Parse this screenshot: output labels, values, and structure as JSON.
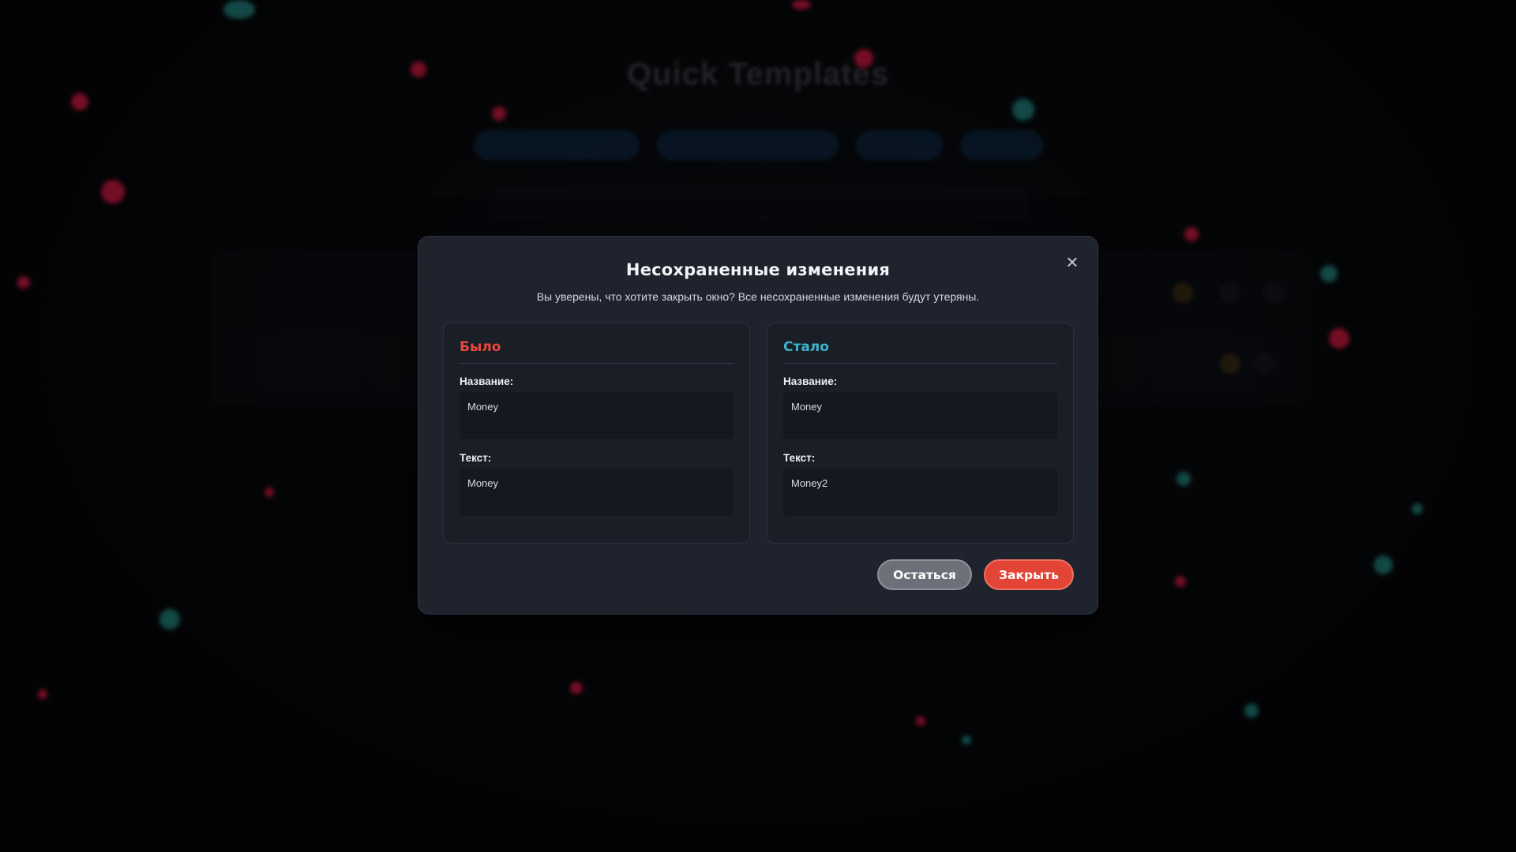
{
  "background": {
    "title": "Quick Templates"
  },
  "modal": {
    "title": "Несохраненные изменения",
    "description": "Вы уверены, что хотите закрыть окно? Все несохраненные изменения будут утеряны.",
    "close_icon": "×",
    "before": {
      "heading": "Было",
      "name_label": "Название:",
      "name_value": "Money",
      "text_label": "Текст:",
      "text_value": "Money"
    },
    "after": {
      "heading": "Стало",
      "name_label": "Название:",
      "name_value": "Money",
      "text_label": "Текст:",
      "text_value": "Money2"
    },
    "buttons": {
      "stay": "Остаться",
      "close": "Закрыть"
    }
  },
  "colors": {
    "before_heading": "#e8493a",
    "after_heading": "#3fb3cf",
    "close_button": "#e24535",
    "stay_button": "#6b7079"
  }
}
